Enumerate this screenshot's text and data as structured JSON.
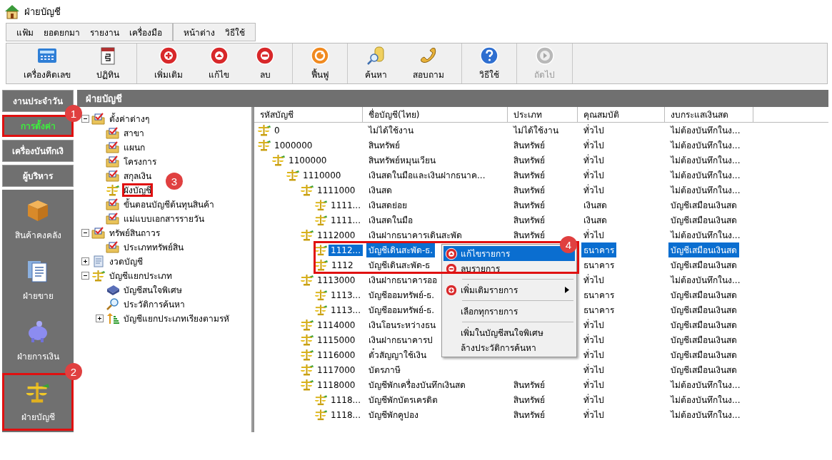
{
  "window": {
    "title": "ฝ่ายบัญชี"
  },
  "menu_groups": [
    [
      "แฟ้ม",
      "ยอดยกมา",
      "รายงาน",
      "เครื่องมือ"
    ],
    [
      "หน้าต่าง",
      "วิธีใช้"
    ]
  ],
  "toolbar": [
    [
      {
        "label": "เครื่องคิดเลข",
        "kind": "calculator",
        "disabled": false
      },
      {
        "label": "ปฏิทิน",
        "kind": "calendar",
        "disabled": false
      }
    ],
    [
      {
        "label": "เพิ่มเติม",
        "kind": "add",
        "disabled": false
      },
      {
        "label": "แก้ไข",
        "kind": "edit",
        "disabled": false
      },
      {
        "label": "ลบ",
        "kind": "delete",
        "disabled": false
      }
    ],
    [
      {
        "label": "ฟื้นฟู",
        "kind": "refresh",
        "disabled": false
      }
    ],
    [
      {
        "label": "ค้นหา",
        "kind": "search",
        "disabled": false
      },
      {
        "label": "สอบถาม",
        "kind": "phone",
        "disabled": false
      }
    ],
    [
      {
        "label": "วิธีใช้",
        "kind": "help",
        "disabled": false
      }
    ],
    [
      {
        "label": "ถัดไป",
        "kind": "next",
        "disabled": true
      }
    ]
  ],
  "nav": {
    "tabs": [
      {
        "label": "งานประจำวัน",
        "selected": false
      },
      {
        "label": "การตั้งค่า",
        "selected": true,
        "callout": "1"
      },
      {
        "label": "เครื่องบันทึกเงิ",
        "selected": false
      },
      {
        "label": "ผู้บริหาร",
        "selected": false
      }
    ],
    "modules": [
      {
        "label": "สินค้าคงคลัง",
        "kind": "box"
      },
      {
        "label": "ฝ่ายขาย",
        "kind": "document"
      },
      {
        "label": "ฝ่ายการเงิน",
        "kind": "piggy"
      },
      {
        "label": "ฝ่ายบัญชี",
        "kind": "scale",
        "callout": "2"
      }
    ]
  },
  "panel_title": "ฝ่ายบัญชี",
  "tree": [
    {
      "label": "ตั้งค่าต่างๆ",
      "kind": "folder",
      "expanded": true,
      "children": [
        {
          "label": "สาขา",
          "kind": "folder"
        },
        {
          "label": "แผนก",
          "kind": "folder"
        },
        {
          "label": "โครงการ",
          "kind": "folder"
        },
        {
          "label": "สกุลเงิน",
          "kind": "folder"
        },
        {
          "label": "ผังบัญชี",
          "kind": "scale",
          "callout": "3"
        },
        {
          "label": "ขั้นตอนบัญชีต้นทุนสินค้า",
          "kind": "folder"
        },
        {
          "label": "แม่แบบเอกสารรายวัน",
          "kind": "folder"
        }
      ]
    },
    {
      "label": "ทรัพย์สินถาวร",
      "kind": "folder",
      "expanded": true,
      "children": [
        {
          "label": "ประเภททรัพย์สิน",
          "kind": "folder"
        }
      ]
    },
    {
      "label": "งวดบัญชี",
      "kind": "document",
      "expanded": false
    },
    {
      "label": "บัญชีแยกประเภท",
      "kind": "scale",
      "expanded": true,
      "children": [
        {
          "label": "บัญชีสนใจพิเศษ",
          "kind": "book"
        },
        {
          "label": "ประวัติการค้นหา",
          "kind": "search"
        },
        {
          "label": "บัญชีแยกประเภทเรียงตามรหั",
          "kind": "sort",
          "expanded": false
        }
      ]
    }
  ],
  "table": {
    "columns": [
      "รหัสบัญชี",
      "ชื่อบัญชี(ไทย)",
      "ประเภท",
      "คุณสมบัติ",
      "งบกระแสเงินสด"
    ],
    "rows": [
      {
        "code": "0",
        "name": "ไม่ได้ใช้งาน",
        "type": "ไม่ได้ใช้งาน",
        "property": "ทั่วไป",
        "cash_flow": "ไม่ต้องบันทึกในง...",
        "selected": false
      },
      {
        "code": "1000000",
        "name": "สินทรัพย์",
        "type": "สินทรัพย์",
        "property": "ทั่วไป",
        "cash_flow": "ไม่ต้องบันทึกในง...",
        "selected": false,
        "children": [
          {
            "code": "1100000",
            "name": "สินทรัพย์หมุนเวียน",
            "type": "สินทรัพย์",
            "property": "ทั่วไป",
            "cash_flow": "ไม่ต้องบันทึกในง...",
            "selected": false,
            "children": [
              {
                "code": "1110000",
                "name": "เงินสดในมือและเงินฝากธนาค...",
                "type": "สินทรัพย์",
                "property": "ทั่วไป",
                "cash_flow": "ไม่ต้องบันทึกในง...",
                "selected": false,
                "children": [
                  {
                    "code": "1111000",
                    "name": "เงินสด",
                    "type": "สินทรัพย์",
                    "property": "ทั่วไป",
                    "cash_flow": "ไม่ต้องบันทึกในง...",
                    "selected": false,
                    "children": [
                      {
                        "code": "1111...",
                        "name": "เงินสดย่อย",
                        "type": "สินทรัพย์",
                        "property": "เงินสด",
                        "cash_flow": "บัญชีเสมือนเงินสด",
                        "selected": false
                      },
                      {
                        "code": "1111...",
                        "name": "เงินสดในมือ",
                        "type": "สินทรัพย์",
                        "property": "เงินสด",
                        "cash_flow": "บัญชีเสมือนเงินสด",
                        "selected": false
                      }
                    ]
                  },
                  {
                    "code": "1112000",
                    "name": "เงินฝากธนาคารเดินสะพัด",
                    "type": "สินทรัพย์",
                    "property": "ทั่วไป",
                    "cash_flow": "ไม่ต้องบันทึกในง...",
                    "selected": false,
                    "children": [
                      {
                        "code": "1112...",
                        "name": "บัญชีเดินสะพัด-ธ.",
                        "property": "ธนาคาร",
                        "cash_flow": "บัญชีเสมือนเงินสด",
                        "selected": true
                      },
                      {
                        "code": "1112",
                        "name": "บัญชีเดินสะพัด-ธ",
                        "property": "ธนาคาร",
                        "cash_flow": "บัญชีเสมือนเงินสด",
                        "selected": false
                      }
                    ]
                  },
                  {
                    "code": "1113000",
                    "name": "เงินฝากธนาคารออ",
                    "property": "ทั่วไป",
                    "cash_flow": "ไม่ต้องบันทึกในง...",
                    "selected": false,
                    "children": [
                      {
                        "code": "1113...",
                        "name": "บัญชีออมทรัพย์-ธ.",
                        "property": "ธนาคาร",
                        "cash_flow": "บัญชีเสมือนเงินสด",
                        "selected": false
                      },
                      {
                        "code": "1113...",
                        "name": "บัญชีออมทรัพย์-ธ.",
                        "property": "ธนาคาร",
                        "cash_flow": "บัญชีเสมือนเงินสด",
                        "selected": false
                      }
                    ]
                  },
                  {
                    "code": "1114000",
                    "name": "เงินโอนระหว่างธน",
                    "property": "ทั่วไป",
                    "cash_flow": "บัญชีเสมือนเงินสด",
                    "selected": false
                  },
                  {
                    "code": "1115000",
                    "name": "เงินฝากธนาคารป",
                    "property": "ทั่วไป",
                    "cash_flow": "บัญชีเสมือนเงินสด",
                    "selected": false
                  },
                  {
                    "code": "1116000",
                    "name": "ตั๋วสัญญาใช้เงิน",
                    "property": "ทั่วไป",
                    "cash_flow": "บัญชีเสมือนเงินสด",
                    "selected": false
                  },
                  {
                    "code": "1117000",
                    "name": "บัตรภาษี",
                    "property": "ทั่วไป",
                    "cash_flow": "บัญชีเสมือนเงินสด",
                    "selected": false
                  },
                  {
                    "code": "1118000",
                    "name": "บัญชีพักเครื่องบันทึกเงินสด",
                    "type": "สินทรัพย์",
                    "property": "ทั่วไป",
                    "cash_flow": "ไม่ต้องบันทึกในง...",
                    "selected": false,
                    "children": [
                      {
                        "code": "1118...",
                        "name": "บัญชีพักบัตรเครดิต",
                        "type": "สินทรัพย์",
                        "property": "ทั่วไป",
                        "cash_flow": "ไม่ต้องบันทึกในง...",
                        "selected": false
                      },
                      {
                        "code": "1118...",
                        "name": "บัญชีพักคูปอง",
                        "type": "สินทรัพย์",
                        "property": "ทั่วไป",
                        "cash_flow": "ไม่ต้องบันทึกในง...",
                        "selected": false
                      }
                    ]
                  }
                ]
              }
            ]
          }
        ]
      }
    ]
  },
  "context_menu": {
    "callout": "4",
    "items": [
      {
        "kind": "edit",
        "label": "แก้ไขรายการ",
        "selected": true,
        "submenu": false
      },
      {
        "kind": "delete",
        "label": "ลบรายการ",
        "selected": false,
        "submenu": false
      },
      {
        "kind": "separator"
      },
      {
        "kind": "add",
        "label": "เพิ่มเติมรายการ",
        "selected": false,
        "submenu": true
      },
      {
        "kind": "separator"
      },
      {
        "kind": "plain",
        "label": "เลือกทุกรายการ",
        "selected": false,
        "submenu": false
      },
      {
        "kind": "separator"
      },
      {
        "kind": "plain",
        "label": "เพิ่มในบัญชีสนใจพิเศษ",
        "selected": false,
        "submenu": false
      },
      {
        "kind": "plain",
        "label": "ล้างประวัติการค้นหา",
        "selected": false,
        "submenu": false
      }
    ]
  }
}
